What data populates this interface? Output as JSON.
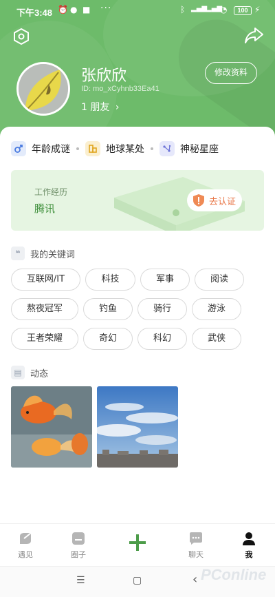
{
  "status_bar": {
    "time": "下午3:48",
    "battery": "100",
    "more": "···"
  },
  "profile": {
    "name": "张欣欣",
    "user_id": "ID: mo_xCyhnb33Ea41",
    "friends": "1 朋友",
    "edit_label": "修改资料"
  },
  "info": {
    "age": "年龄成谜",
    "location": "地球某处",
    "zodiac": "神秘星座"
  },
  "work": {
    "label": "工作经历",
    "company": "腾讯",
    "certify_label": "去认证"
  },
  "keywords": {
    "title": "我的关键词",
    "tags": [
      "互联网/IT",
      "科技",
      "军事",
      "阅读",
      "熬夜冠军",
      "钓鱼",
      "骑行",
      "游泳",
      "王者荣耀",
      "奇幻",
      "科幻",
      "武侠"
    ]
  },
  "moments": {
    "title": "动态",
    "photos": [
      "goldfish-photo",
      "sky-clouds-photo"
    ]
  },
  "bottom_nav": {
    "items": [
      "遇见",
      "圈子",
      "",
      "聊天",
      "我"
    ],
    "active_index": 4
  },
  "system_nav": {
    "menu": "☰",
    "home": "▢",
    "back": "‹"
  },
  "watermark": "PConline",
  "colors": {
    "header_green": "#6dbb6a",
    "accent_green": "#3e8f3b",
    "certify_orange": "#e9784a"
  }
}
